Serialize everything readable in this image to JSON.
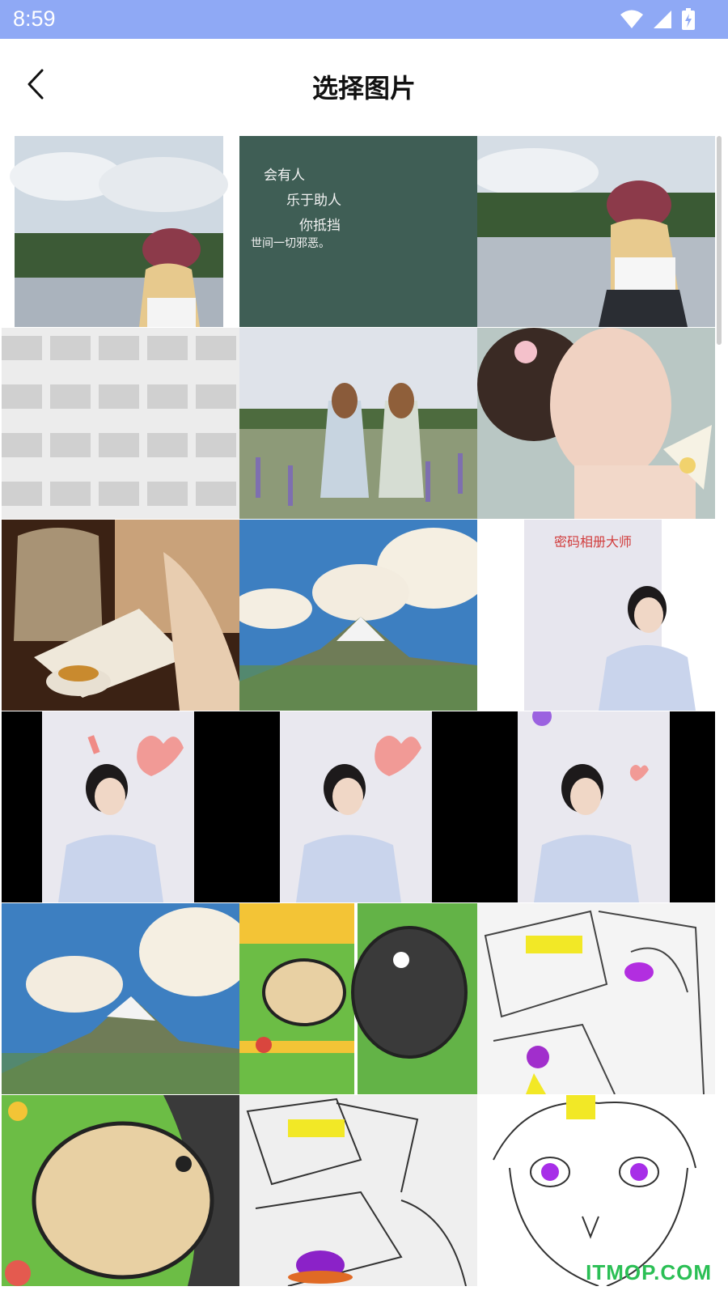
{
  "status_bar": {
    "time": "8:59",
    "icons": [
      "wifi-icon",
      "signal-icon",
      "battery-charging-icon"
    ]
  },
  "app_bar": {
    "title": "选择图片",
    "back_icon": "chevron-left-icon"
  },
  "colors": {
    "status_bar": "#8fa9f5",
    "background": "#ffffff",
    "watermark": "#2bbf55"
  },
  "photos": [
    {
      "name": "girl-hat-lake"
    },
    {
      "name": "green-quote-card",
      "lines": [
        "会有人",
        "乐于助人",
        "你抵挡",
        "世间一切邪恶。"
      ]
    },
    {
      "name": "girl-hat-lake-dock"
    },
    {
      "name": "white-building-facade"
    },
    {
      "name": "two-girls-lavender-field"
    },
    {
      "name": "girl-flowers-painting"
    },
    {
      "name": "reading-book-tea"
    },
    {
      "name": "anime-mountain-clouds"
    },
    {
      "name": "password-album-poster",
      "caption": "密码相册大师"
    },
    {
      "name": "girl-heart-sticker-1"
    },
    {
      "name": "girl-heart-sticker-2"
    },
    {
      "name": "girl-flower-sticker"
    },
    {
      "name": "anime-mountain-clouds-2"
    },
    {
      "name": "cartoon-dogs-collage"
    },
    {
      "name": "sketch-girl-colored"
    },
    {
      "name": "cartoon-dog-closeup"
    },
    {
      "name": "sketch-hands-colored"
    },
    {
      "name": "sketch-girl-purple-eyes"
    }
  ],
  "watermark": "ITMOP.COM"
}
